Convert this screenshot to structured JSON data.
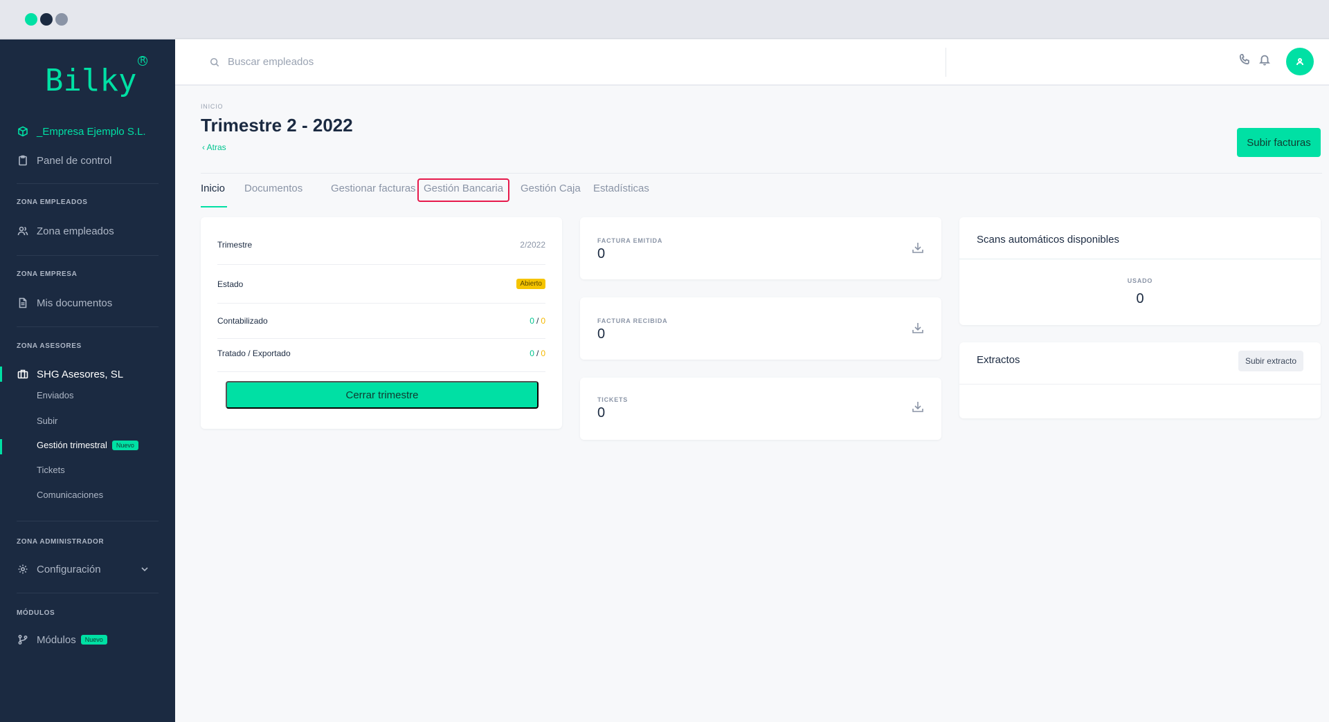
{
  "window": {
    "dot_colors": [
      "#00e0a4",
      "#1b2a41",
      "#8a94a6"
    ]
  },
  "sidebar": {
    "logo": "Bilky",
    "logo_mark": "R",
    "company": "_Empresa Ejemplo S.L.",
    "panel": "Panel de control",
    "sections": {
      "empleados": "ZONA EMPLEADOS",
      "empresa": "ZONA EMPRESA",
      "asesores": "ZONA ASESORES",
      "administrador": "ZONA ADMINISTRADOR",
      "modulos": "MÓDULOS"
    },
    "zona_empleados": "Zona empleados",
    "mis_documentos": "Mis documentos",
    "asesores_name": "SHG Asesores, SL",
    "sub_items": {
      "enviados": "Enviados",
      "subir": "Subir",
      "gestion_trimestral": "Gestión trimestral",
      "tickets": "Tickets",
      "comunicaciones": "Comunicaciones"
    },
    "nuevo_badge": "Nuevo",
    "configuracion": "Configuración",
    "modulos": "Módulos"
  },
  "topbar": {
    "search_placeholder": "Buscar empleados"
  },
  "page": {
    "breadcrumb": "INICIO",
    "title": "Trimestre 2 - 2022",
    "back": "Atras",
    "upload_button": "Subir facturas",
    "tabs": [
      "Inicio",
      "Documentos",
      "Gestionar facturas",
      "Gestión Bancaria",
      "Gestión Caja",
      "Estadísticas"
    ],
    "active_tab": "Inicio",
    "highlighted_tab": "Gestión Bancaria"
  },
  "summary": {
    "trimestre_label": "Trimestre",
    "trimestre_value": "2/2022",
    "estado_label": "Estado",
    "estado_value": "Abierto",
    "contabilizado_label": "Contabilizado",
    "contabilizado_done": "0",
    "contabilizado_total": "0",
    "tratado_label": "Tratado / Exportado",
    "tratado_done": "0",
    "tratado_total": "0",
    "separator": "/",
    "close_button": "Cerrar trimestre"
  },
  "stats": [
    {
      "label": "FACTURA EMITIDA",
      "value": "0"
    },
    {
      "label": "FACTURA RECIBIDA",
      "value": "0"
    },
    {
      "label": "TICKETS",
      "value": "0"
    }
  ],
  "scans": {
    "title": "Scans automáticos disponibles",
    "used_label": "USADO",
    "used_value": "0"
  },
  "extractos": {
    "title": "Extractos",
    "upload_button": "Subir extracto"
  },
  "colors": {
    "accent": "#00e0a4",
    "sidebar_bg": "#1b2a41",
    "highlight": "#e6194b",
    "status_open": "#f5c400"
  }
}
